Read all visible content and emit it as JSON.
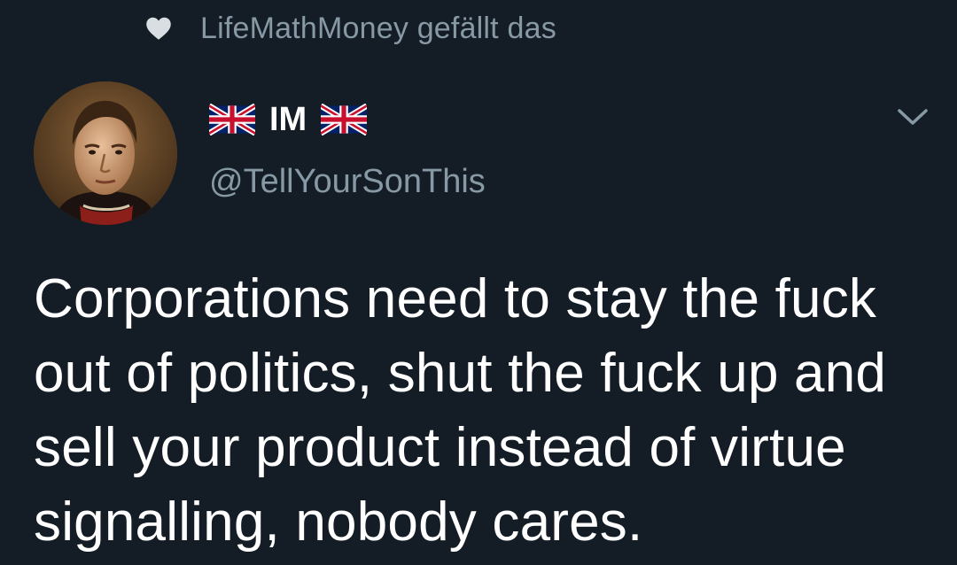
{
  "social_context": {
    "icon": "heart-icon",
    "text": "LifeMathMoney gefällt das"
  },
  "author": {
    "display_name": "IM",
    "flag_icon": "uk-flag-icon",
    "handle": "@TellYourSonThis",
    "avatar_icon": "avatar-portrait"
  },
  "menu": {
    "icon": "chevron-down-icon"
  },
  "tweet": {
    "text": "Corporations need to stay the fuck out of politics, shut the fuck up and sell your product instead of virtue signalling, nobody cares."
  },
  "colors": {
    "background": "#141d26",
    "primary_text": "#ffffff",
    "secondary_text": "#8899a6"
  }
}
